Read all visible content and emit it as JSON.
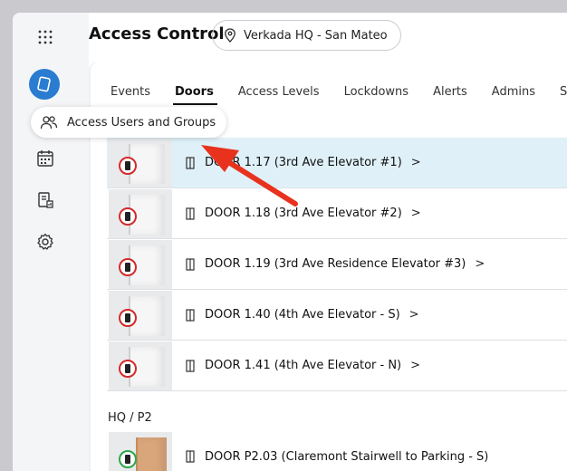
{
  "header": {
    "title": "Access Control",
    "site": "Verkada HQ - San Mateo"
  },
  "tabs": [
    {
      "label": "Events",
      "active": false
    },
    {
      "label": "Doors",
      "active": true
    },
    {
      "label": "Access Levels",
      "active": false
    },
    {
      "label": "Lockdowns",
      "active": false
    },
    {
      "label": "Alerts",
      "active": false
    },
    {
      "label": "Admins",
      "active": false
    },
    {
      "label": "Settin",
      "active": false
    }
  ],
  "tooltip": {
    "label": "Access Users and Groups"
  },
  "doors": [
    {
      "label": "DOOR 1.17 (3rd Ave Elevator #1)",
      "selected": true
    },
    {
      "label": "DOOR 1.18 (3rd Ave Elevator #2)",
      "selected": false
    },
    {
      "label": "DOOR 1.19 (3rd Ave Residence Elevator #3)",
      "selected": false
    },
    {
      "label": "DOOR 1.40 (4th Ave Elevator - S)",
      "selected": false
    },
    {
      "label": "DOOR 1.41 (4th Ave Elevator - N)",
      "selected": false
    }
  ],
  "group2": {
    "label": "HQ / P2",
    "doors": [
      {
        "label": "DOOR P2.03 (Claremont Stairwell to Parking - S)"
      }
    ]
  },
  "chevron": ">",
  "colors": {
    "brand": "#2a7cd0",
    "selected_row": "#dff0f8",
    "lock_badge": "#d42a2a",
    "unlock_badge": "#2aa84a",
    "annotation_arrow": "#e8321e"
  },
  "icons": {
    "rail": [
      "apps-grid-icon",
      "brand-logo-icon",
      "calendar-icon",
      "report-icon",
      "gear-icon"
    ],
    "tooltip": "users-icon",
    "site": "location-pin-icon",
    "door": "door-icon"
  }
}
